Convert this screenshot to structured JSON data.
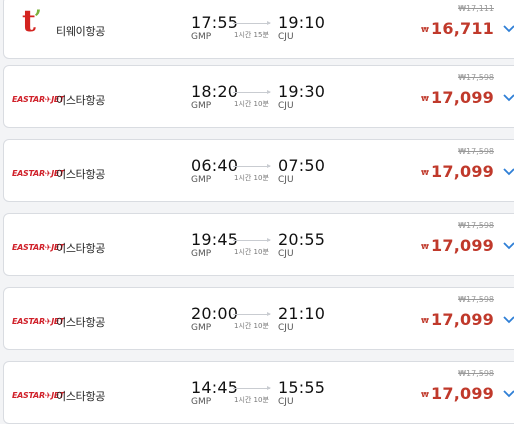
{
  "colors": {
    "price": "#c0392b",
    "chevron": "#2f7fd6",
    "eastar_brand": "#d0212a",
    "tway_brand": "#d3231f"
  },
  "flights": [
    {
      "logo": "tway",
      "logo_text": "t",
      "airline": "티웨이항공",
      "dep_time": "17:55",
      "dep_code": "GMP",
      "arr_time": "19:10",
      "arr_code": "CJU",
      "duration": "1시간 15분",
      "old_price": "₩17,111",
      "currency": "₩",
      "price": "16,711",
      "icon": "chevron-down-icon"
    },
    {
      "logo": "eastar",
      "logo_text": "EASTAR✈JET",
      "airline": "이스타항공",
      "dep_time": "18:20",
      "dep_code": "GMP",
      "arr_time": "19:30",
      "arr_code": "CJU",
      "duration": "1시간 10분",
      "old_price": "₩17,598",
      "currency": "₩",
      "price": "17,099",
      "icon": "chevron-down-icon"
    },
    {
      "logo": "eastar",
      "logo_text": "EASTAR✈JET",
      "airline": "이스타항공",
      "dep_time": "06:40",
      "dep_code": "GMP",
      "arr_time": "07:50",
      "arr_code": "CJU",
      "duration": "1시간 10분",
      "old_price": "₩17,598",
      "currency": "₩",
      "price": "17,099",
      "icon": "chevron-down-icon"
    },
    {
      "logo": "eastar",
      "logo_text": "EASTAR✈JET",
      "airline": "이스타항공",
      "dep_time": "19:45",
      "dep_code": "GMP",
      "arr_time": "20:55",
      "arr_code": "CJU",
      "duration": "1시간 10분",
      "old_price": "₩17,598",
      "currency": "₩",
      "price": "17,099",
      "icon": "chevron-down-icon"
    },
    {
      "logo": "eastar",
      "logo_text": "EASTAR✈JET",
      "airline": "이스타항공",
      "dep_time": "20:00",
      "dep_code": "GMP",
      "arr_time": "21:10",
      "arr_code": "CJU",
      "duration": "1시간 10분",
      "old_price": "₩17,598",
      "currency": "₩",
      "price": "17,099",
      "icon": "chevron-down-icon"
    },
    {
      "logo": "eastar",
      "logo_text": "EASTAR✈JET",
      "airline": "이스타항공",
      "dep_time": "14:45",
      "dep_code": "GMP",
      "arr_time": "15:55",
      "arr_code": "CJU",
      "duration": "1시간 10분",
      "old_price": "₩17,598",
      "currency": "₩",
      "price": "17,099",
      "icon": "chevron-down-icon"
    }
  ]
}
